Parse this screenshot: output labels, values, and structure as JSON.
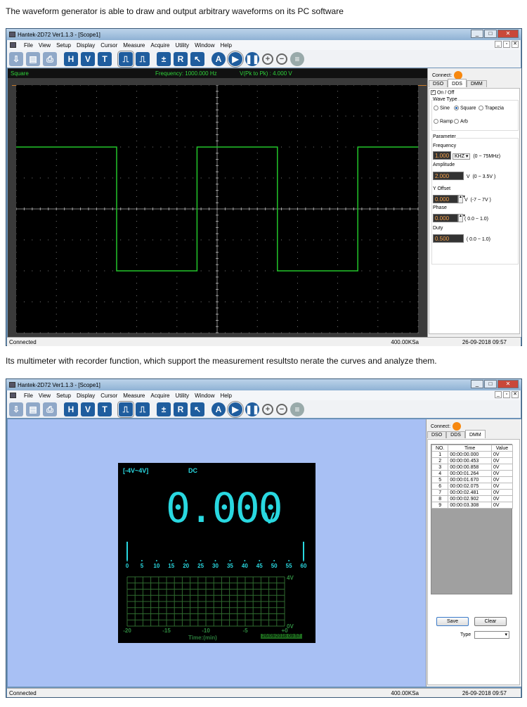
{
  "captions": [
    "The waveform generator is able to draw and output arbitrary waveforms on its PC software",
    "Its multimeter with recorder function, which support the measurement resultsto nerate the curves and analyze them."
  ],
  "app": {
    "title": "Hantek-2D72 Ver1.1.3 - [Scope1]",
    "menu": [
      "File",
      "View",
      "Setup",
      "Display",
      "Cursor",
      "Measure",
      "Acquire",
      "Utility",
      "Window",
      "Help"
    ],
    "toolbar": [
      {
        "icon": "open-icon",
        "t": "⇩"
      },
      {
        "icon": "save-icon",
        "t": "▤"
      },
      {
        "icon": "print-icon",
        "t": "⎙"
      },
      {
        "icon": "horizontal-icon",
        "t": "H"
      },
      {
        "icon": "vertical-icon",
        "t": "V"
      },
      {
        "icon": "trigger-icon",
        "t": "T"
      },
      {
        "icon": "dso-mode-icon",
        "t": "⎍"
      },
      {
        "icon": "dds-mode-icon",
        "t": "⎍"
      },
      {
        "icon": "math-icon",
        "t": "±"
      },
      {
        "icon": "reference-icon",
        "t": "R"
      },
      {
        "icon": "cursor-icon",
        "t": "↖"
      },
      {
        "icon": "auto-icon",
        "t": "A"
      },
      {
        "icon": "run-icon",
        "t": "▶"
      },
      {
        "icon": "pause-icon",
        "t": "❚❚"
      },
      {
        "icon": "zoom-in-icon",
        "t": "+"
      },
      {
        "icon": "zoom-out-icon",
        "t": "−"
      },
      {
        "icon": "clear-icon",
        "t": "≡"
      }
    ],
    "window_buttons": [
      "_",
      "□",
      "✕"
    ],
    "mdi_buttons": [
      "_",
      "▫",
      "✕"
    ],
    "connect_label": "Connect:",
    "tabs": [
      "DSO",
      "DDS",
      "DMM"
    ],
    "status": {
      "left": "Connected",
      "rate": "400.00KSa",
      "datetime": "26-09-2018  09:57"
    }
  },
  "colors": {
    "trace": "#22c62a",
    "grid": "#a8a8a8",
    "dmm_cyan": "#29d8e0",
    "connect": "#f7880f",
    "field_text": "#f7a24a",
    "dmm_bg": "#a8c0f4"
  },
  "scope": {
    "wave_name": "Square",
    "frequency": "Frequency: 1000.000 Hz",
    "vpp": "V(Pk to Pk) : 4.000 V",
    "high_level": 2,
    "low_level": -2,
    "period_divisions": 4
  },
  "dds": {
    "onoff": "On / Off",
    "wave_type_label": "Wave Type",
    "wave_types": [
      "Sine",
      "Square",
      "Trapezia",
      "Ramp",
      "Arb"
    ],
    "selected": "Square",
    "parameter_label": "Parameter",
    "frequency": {
      "label": "Frequency",
      "value": "1.000",
      "unit": "KHZ",
      "range": "(0 ~ 75MHz)"
    },
    "amplitude": {
      "label": "Amplitude",
      "value": "2.000",
      "unit": "V",
      "range": "(0 ~ 3.5V )"
    },
    "offset": {
      "label": "Y Offset",
      "value": "0.000",
      "unit": "V",
      "range": "(-7  ~ 7V )"
    },
    "phase": {
      "label": "Phase",
      "value": "0.000",
      "range": "( 0.0 ~ 1.0)"
    },
    "duty": {
      "label": "Duty",
      "value": "0.500",
      "range": "( 0.0 ~ 1.0)"
    }
  },
  "dmm": {
    "range": "[-4V~4V]",
    "mode": "DC",
    "reading": "0.000",
    "unit": "V",
    "bar_ticks": [
      "0",
      "5",
      "10",
      "15",
      "20",
      "25",
      "30",
      "35",
      "40",
      "45",
      "50",
      "55",
      "60"
    ],
    "y_max": "4V",
    "y_min": "0V",
    "x_ticks": [
      "-20",
      "-15",
      "-10",
      "-5",
      "+0"
    ],
    "x_label": "Time:(min)",
    "datetime": "26/09/2018  09:57",
    "table_headers": [
      "NO.",
      "Time",
      "Value"
    ],
    "rows": [
      [
        "1",
        "00:00:00.000",
        "0V"
      ],
      [
        "2",
        "00:00:00.453",
        "0V"
      ],
      [
        "3",
        "00:00:00.858",
        "0V"
      ],
      [
        "4",
        "00:00:01.264",
        "0V"
      ],
      [
        "5",
        "00:00:01.670",
        "0V"
      ],
      [
        "6",
        "00:00:02.075",
        "0V"
      ],
      [
        "7",
        "00:00:02.481",
        "0V"
      ],
      [
        "8",
        "00:00:02.902",
        "0V"
      ],
      [
        "9",
        "00:00:03.308",
        "0V"
      ]
    ],
    "save": "Save",
    "clear": "Clear",
    "type_label": "Type"
  }
}
